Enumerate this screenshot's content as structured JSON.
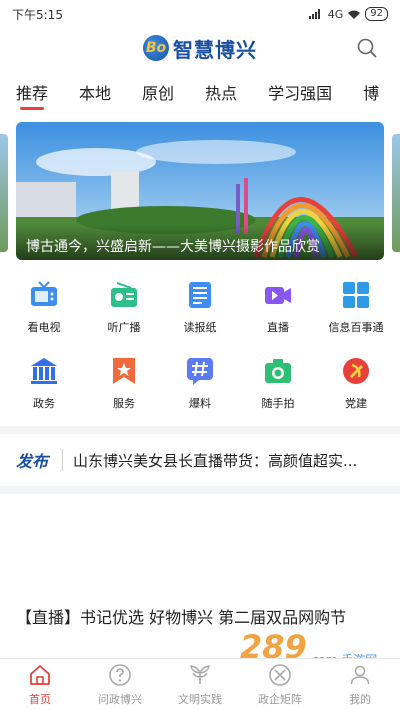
{
  "status_bar": {
    "time": "下午5:15",
    "network": "4G",
    "battery": "92"
  },
  "header": {
    "app_title": "智慧博兴",
    "logo_mark": "Bo"
  },
  "tabs": [
    {
      "label": "推荐",
      "active": true
    },
    {
      "label": "本地"
    },
    {
      "label": "原创"
    },
    {
      "label": "热点"
    },
    {
      "label": "学习强国"
    },
    {
      "label": "博"
    }
  ],
  "banner": {
    "caption": "博古通今，兴盛启新——大美博兴摄影作品欣赏"
  },
  "grid": [
    {
      "label": "看电视",
      "icon": "tv-icon",
      "color": "#3d8ef0"
    },
    {
      "label": "听广播",
      "icon": "radio-icon",
      "color": "#2fbf8b"
    },
    {
      "label": "读报纸",
      "icon": "newspaper-icon",
      "color": "#3d8ef0"
    },
    {
      "label": "直播",
      "icon": "video-camera-icon",
      "color": "#8a56f0"
    },
    {
      "label": "信息百事通",
      "icon": "app-grid-icon",
      "color": "#2d9be8"
    },
    {
      "label": "政务",
      "icon": "government-building-icon",
      "color": "#2f6fe8"
    },
    {
      "label": "服务",
      "icon": "service-bookmark-icon",
      "color": "#f06a3c"
    },
    {
      "label": "爆料",
      "icon": "hashtag-icon",
      "color": "#5a7cf0"
    },
    {
      "label": "随手拍",
      "icon": "camera-icon",
      "color": "#2fbf74"
    },
    {
      "label": "党建",
      "icon": "party-emblem-icon",
      "color": "#e8413c"
    }
  ],
  "ticker": {
    "brand": "发布",
    "headline": "山东博兴美女县长直播带货：高颜值超实..."
  },
  "article": {
    "title": "【直播】书记优选 好物博兴 第二届双品网购节"
  },
  "watermark": {
    "text": "289",
    "sub": ".com 手游网"
  },
  "bottom_nav": [
    {
      "label": "首页",
      "icon": "home-icon",
      "active": true
    },
    {
      "label": "问政博兴",
      "icon": "question-icon"
    },
    {
      "label": "文明实践",
      "icon": "civilization-emblem-icon"
    },
    {
      "label": "政企矩阵",
      "icon": "matrix-icon"
    },
    {
      "label": "我的",
      "icon": "user-icon"
    }
  ],
  "colors": {
    "accent": "#e8413c",
    "brand_blue": "#1b4fa0",
    "muted": "#999999"
  }
}
